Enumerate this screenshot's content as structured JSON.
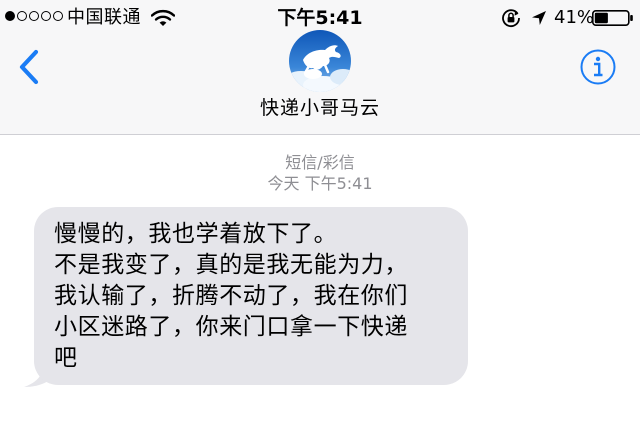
{
  "status_bar": {
    "carrier": "中国联通",
    "time": "下午5:41",
    "battery_percent": "41%",
    "battery_level": 0.41,
    "signal_bars": 1,
    "signal_max": 5
  },
  "nav": {
    "back_icon": "chevron-left-icon",
    "info_icon": "info-icon",
    "contact_name": "快递小哥马云",
    "accent_color": "#1a7cf5"
  },
  "conversation": {
    "message_type": "短信/彩信",
    "timestamp": "今天 下午5:41",
    "messages": [
      {
        "direction": "incoming",
        "text": "慢慢的，我也学着放下了。\n不是我变了，真的是我无能为力，\n我认输了，折腾不动了，我在你们\n小区迷路了，你来门口拿一下快递\n吧"
      }
    ]
  }
}
